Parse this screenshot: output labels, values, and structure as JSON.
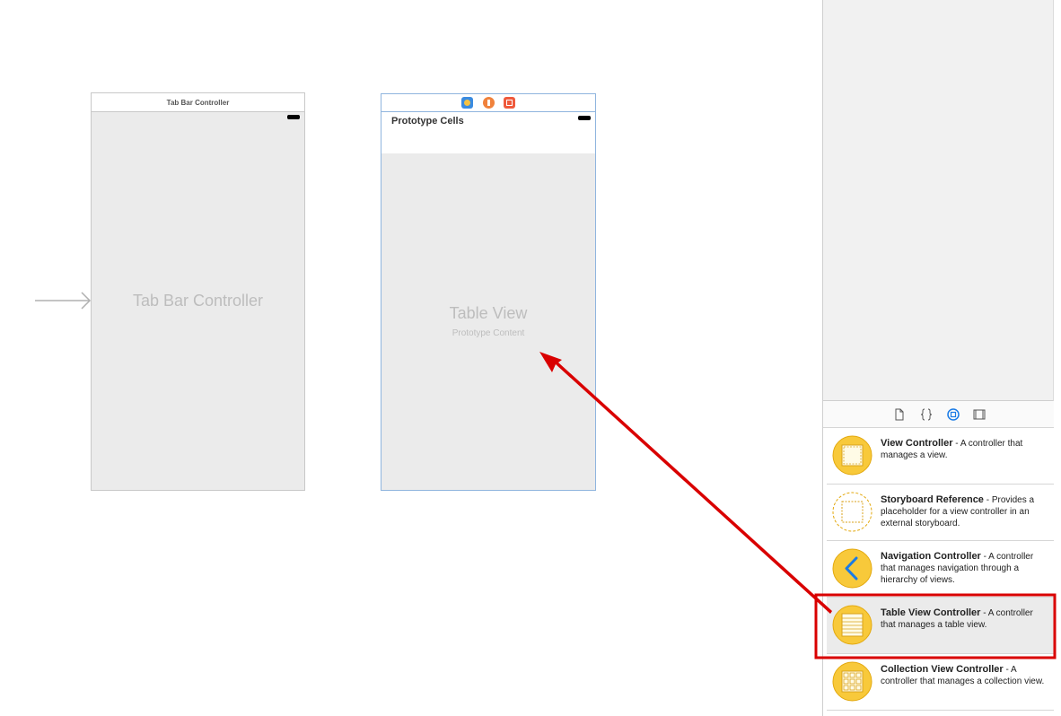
{
  "canvas": {
    "tab_bar_scene": {
      "title": "Tab Bar Controller",
      "center_label": "Tab Bar Controller"
    },
    "table_scene": {
      "header_label": "Prototype Cells",
      "center_label": "Table View",
      "sub_label": "Prototype Content"
    }
  },
  "library": {
    "tabs": [
      "file-template",
      "code-snippet",
      "object",
      "media"
    ],
    "selected_tab": "object",
    "items": [
      {
        "name": "View Controller",
        "desc": " - A controller that manages a view.",
        "icon": "view-controller-icon"
      },
      {
        "name": "Storyboard Reference",
        "desc": " - Provides a placeholder for a view controller in an external storyboard.",
        "icon": "storyboard-reference-icon"
      },
      {
        "name": "Navigation Controller",
        "desc": " - A controller that manages navigation through a hierarchy of views.",
        "icon": "navigation-controller-icon"
      },
      {
        "name": "Table View Controller",
        "desc": " - A controller that manages a table view.",
        "icon": "table-view-controller-icon"
      },
      {
        "name": "Collection View Controller",
        "desc": " - A controller that manages a collection view.",
        "icon": "collection-view-controller-icon"
      }
    ]
  },
  "colors": {
    "annotation_red": "#d90000",
    "icon_yellow": "#f8c93a",
    "icon_border": "#e3a90f",
    "scene_selected_border": "#8fb5de"
  }
}
